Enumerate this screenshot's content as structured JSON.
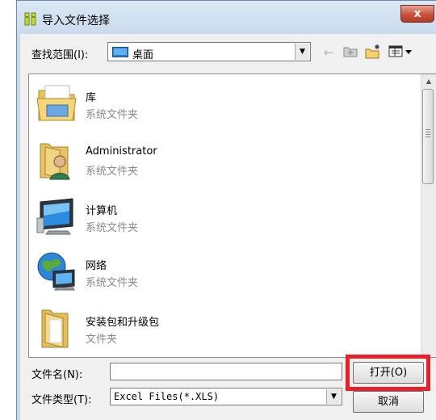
{
  "window": {
    "title": "导入文件选择",
    "close_glyph": "x"
  },
  "look_in": {
    "label": "查找范围(I):",
    "value": "桌面",
    "icon": "desktop-icon"
  },
  "toolbar": {
    "back_icon": "back-arrow-icon",
    "up_icon": "up-folder-icon",
    "new_folder_icon": "new-folder-icon",
    "view_menu_icon": "view-menu-icon"
  },
  "items": [
    {
      "name": "库",
      "type": "系统文件夹",
      "icon": "libraries-folder-icon"
    },
    {
      "name": "Administrator",
      "type": "系统文件夹",
      "icon": "user-folder-icon"
    },
    {
      "name": "计算机",
      "type": "系统文件夹",
      "icon": "computer-icon"
    },
    {
      "name": "网络",
      "type": "系统文件夹",
      "icon": "network-icon"
    },
    {
      "name": "安装包和升级包",
      "type": "文件夹",
      "icon": "folder-icon"
    }
  ],
  "file_name": {
    "label": "文件名(N):",
    "value": ""
  },
  "file_type": {
    "label": "文件类型(T):",
    "value": "Excel Files(*.XLS)"
  },
  "buttons": {
    "open": "打开(O)",
    "cancel": "取消"
  },
  "colors": {
    "highlight": "#e8202a",
    "frame": "#c9d9ea",
    "secondary_text": "#8a8a8a"
  }
}
